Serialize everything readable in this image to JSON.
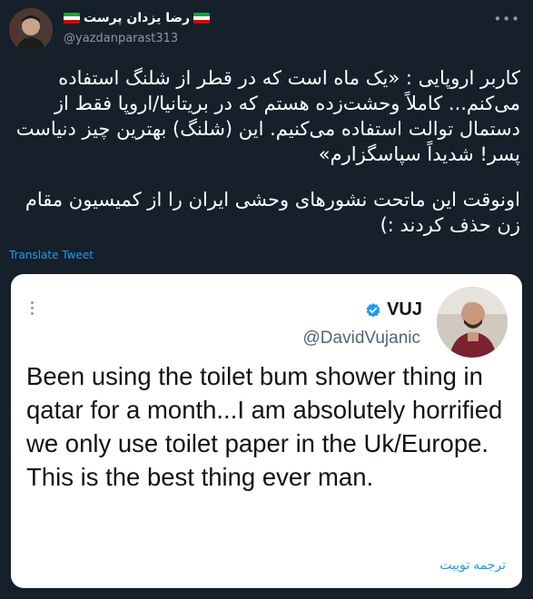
{
  "tweet": {
    "display_name": "رضا یزدان پرست",
    "handle": "@yazdanparast313",
    "body_paragraph_1": "کاربر اروپایی : «یک ماه است که در قطر از شلنگ استفاده می‌کنم... کاملاً وحشت‌زده هستم که در بریتانیا/اروپا فقط از دستمال توالت استفاده می‌کنیم. این (شلنگ) بهترین چیز دنیاست پسر! شدیداً سپاسگزارم»",
    "body_paragraph_2": "اونوقت این ماتحت نشورهای وحشی ایران را از کمیسیون مقام زن حذف کردند :)",
    "translate_label": "Translate Tweet",
    "flag_colors": [
      "#239f40",
      "#ffffff",
      "#da0000"
    ]
  },
  "quoted_card": {
    "name": "VUJ",
    "handle": "@DavidVujanic",
    "text": "Been using the toilet bum shower thing in qatar for a month...I am absolutely horrified we only use toilet paper in the Uk/Europe. This is the best thing ever man.",
    "translate_label": "ترجمه توییت",
    "verified_color": "#1d9bf0"
  }
}
